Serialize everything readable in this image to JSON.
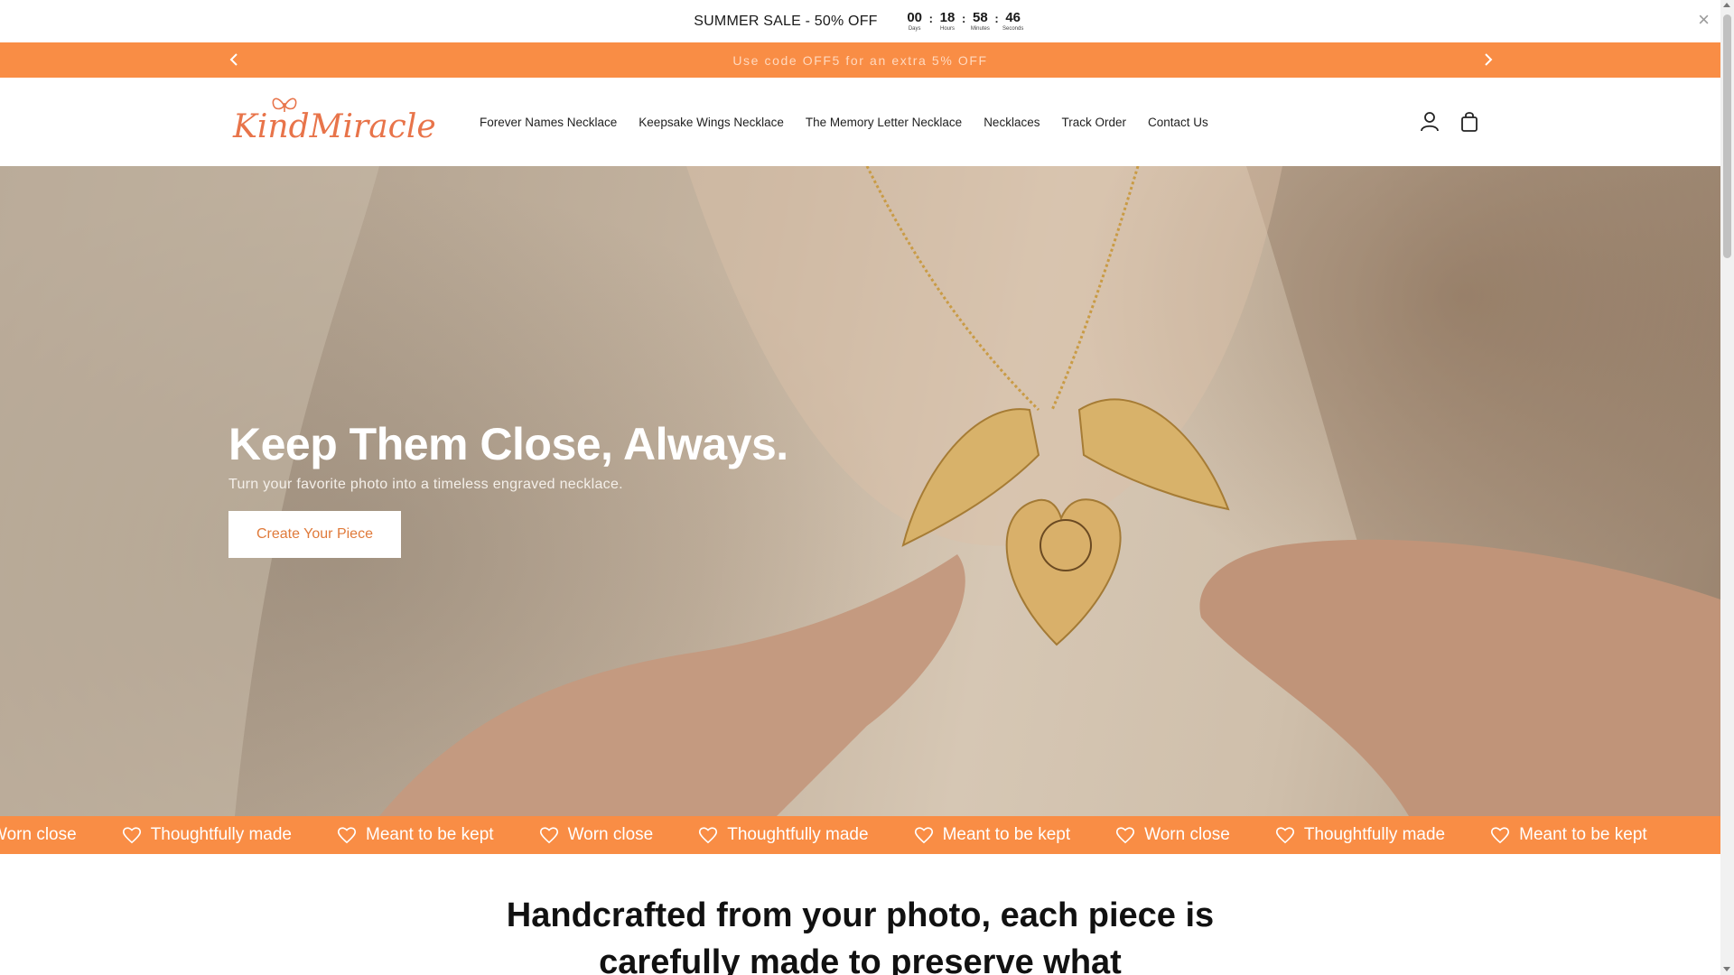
{
  "countdown": {
    "sale_text": "SUMMER SALE - 50% OFF",
    "units": [
      {
        "value": "00",
        "label": "Days"
      },
      {
        "value": "18",
        "label": "Hours"
      },
      {
        "value": "58",
        "label": "Minutes"
      },
      {
        "value": "46",
        "label": "Seconds"
      }
    ],
    "close_label": "×"
  },
  "announcement": {
    "text": "Use code OFF5 for an extra 5% OFF"
  },
  "header": {
    "logo_text": "KindMiracle",
    "nav": [
      "Forever Names Necklace",
      "Keepsake Wings Necklace",
      "The Memory Letter Necklace",
      "Necklaces",
      "Track Order",
      "Contact Us"
    ],
    "icons": [
      "account-icon",
      "cart-icon"
    ]
  },
  "hero": {
    "title": "Keep Them Close, Always.",
    "subtitle": "Turn your favorite photo into a timeless engraved necklace.",
    "button_label": "Create Your Piece"
  },
  "marquee": {
    "items": [
      "Worn close",
      "Thoughtfully made",
      "Meant to be kept",
      "Worn close",
      "Thoughtfully made",
      "Meant to be kept",
      "Worn close",
      "Thoughtfully made",
      "Meant to be kept"
    ]
  },
  "intro": {
    "text": "Handcrafted from your photo, each piece is carefully made to preserve what"
  },
  "colors": {
    "accent": "#f98d45",
    "logo": "#e8744a"
  }
}
